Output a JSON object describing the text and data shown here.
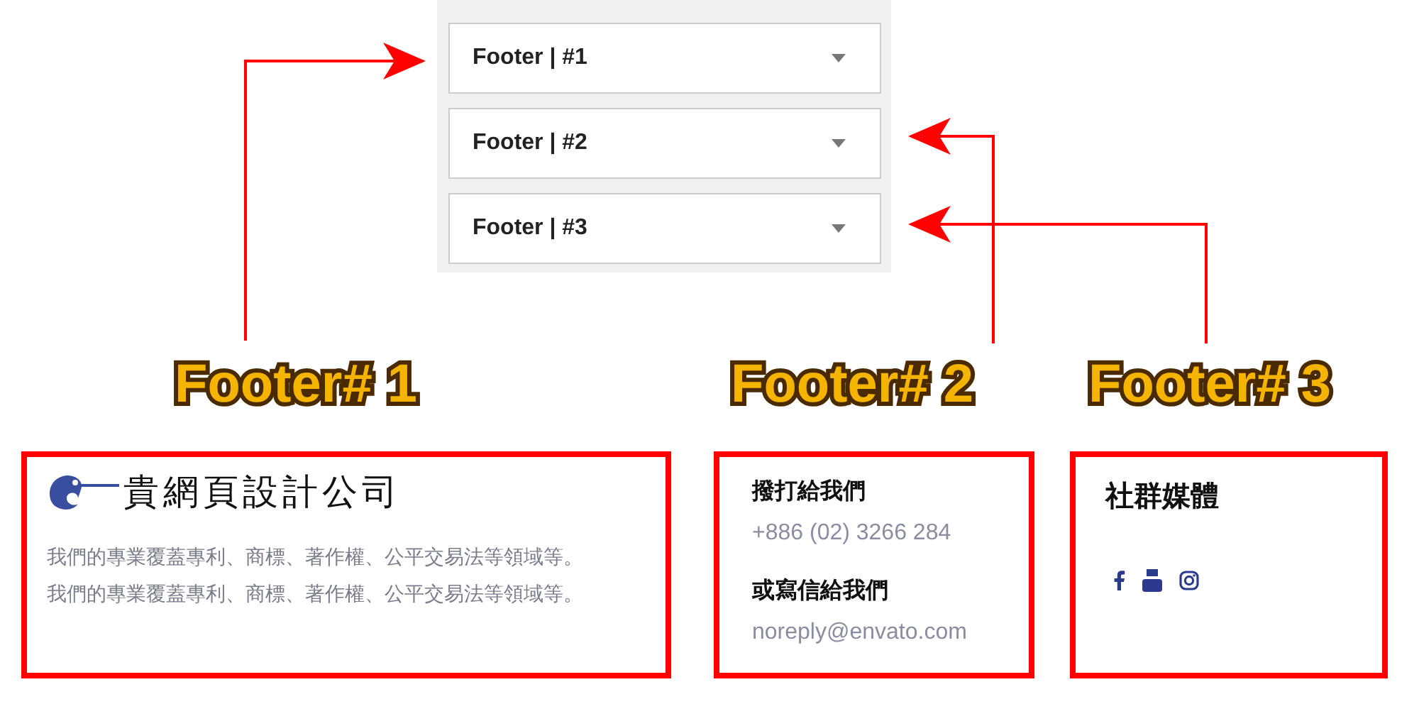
{
  "panel": {
    "items": [
      {
        "label": "Footer | #1",
        "expanded": false
      },
      {
        "label": "Footer | #2",
        "expanded": false
      },
      {
        "label": "Footer | #3",
        "expanded": false
      }
    ]
  },
  "labels": [
    "Footer# 1",
    "Footer# 2",
    "Footer# 3"
  ],
  "footer_1": {
    "logo_text": "貴網頁設計公司",
    "lines": [
      "我們的專業覆蓋專利、商標、著作權、公平交易法等領域等。",
      "我們的專業覆蓋專利、商標、著作權、公平交易法等領域等。"
    ]
  },
  "footer_2": {
    "call_heading": "撥打給我們",
    "phone": "+886 (02) 3266 284",
    "mail_heading": "或寫信給我們",
    "email": "noreply@envato.com"
  },
  "footer_3": {
    "heading": "社群媒體"
  }
}
